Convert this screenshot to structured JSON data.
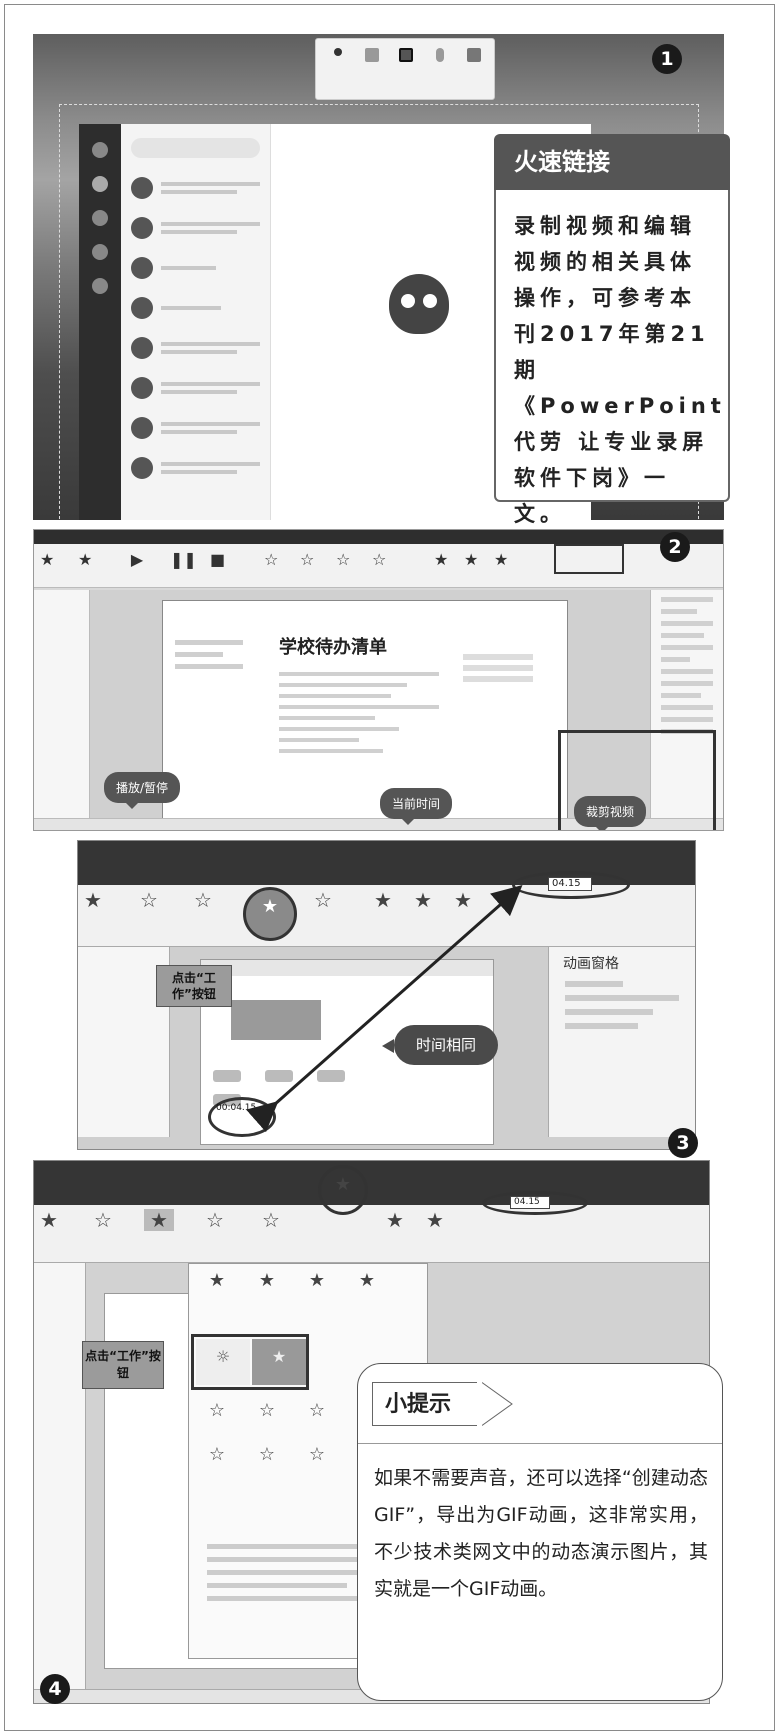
{
  "steps": {
    "s1": "1",
    "s2": "2",
    "s3": "3",
    "s4": "4"
  },
  "callout_link": {
    "title": "火速链接",
    "body": "录制视频和编辑视频的相关具体操作，可参考本刊2017年第21期《PowerPoint代劳 让专业录屏软件下岗》一文。"
  },
  "panel2": {
    "slide_heading": "学校待办清单",
    "bubble_play": "播放/暂停",
    "bubble_time": "当前时间",
    "bubble_crop": "裁剪视频"
  },
  "panel3": {
    "tag_work": "点击“工作”按钮",
    "duration_value": "04.15",
    "time_value": "00:04.15",
    "bubble_same_time": "时间相同",
    "pane_title": "动画窗格"
  },
  "panel4": {
    "tag_work": "点击“工作”按钮",
    "duration_value": "04.15"
  },
  "tip": {
    "title": "小提示",
    "body": "如果不需要声音，还可以选择“创建动态GIF”，导出为GIF动画，这非常实用，不少技术类网文中的动态演示图片，其实就是一个GIF动画。"
  }
}
